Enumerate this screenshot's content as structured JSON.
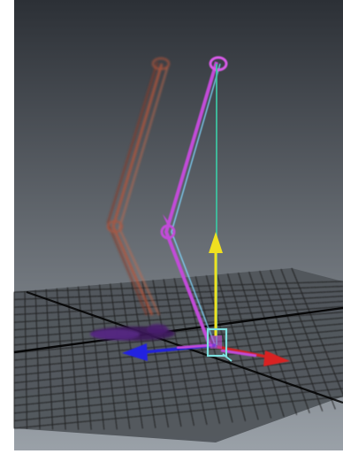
{
  "viewport": {
    "background_top": "#2c3036",
    "background_bottom": "#9aa1a8",
    "frame_color": "#ffffff"
  },
  "grid": {
    "line_color": "#1c1c1c",
    "plane_color": "#555a60",
    "axis_line_color": "#000000"
  },
  "rig": {
    "ghost_chain_color": "#b5553a",
    "selected_chain_color": "#c24bd8",
    "highlight_color": "#7fd6ff",
    "ik_handle_color": "#3a1a5a"
  },
  "manipulator": {
    "y_axis_color": "#f0e020",
    "x_axis_color": "#d02020",
    "z_axis_color": "#2020d8",
    "center_box_color": "#7de0e0",
    "y_line_color": "#3ec2a0"
  }
}
